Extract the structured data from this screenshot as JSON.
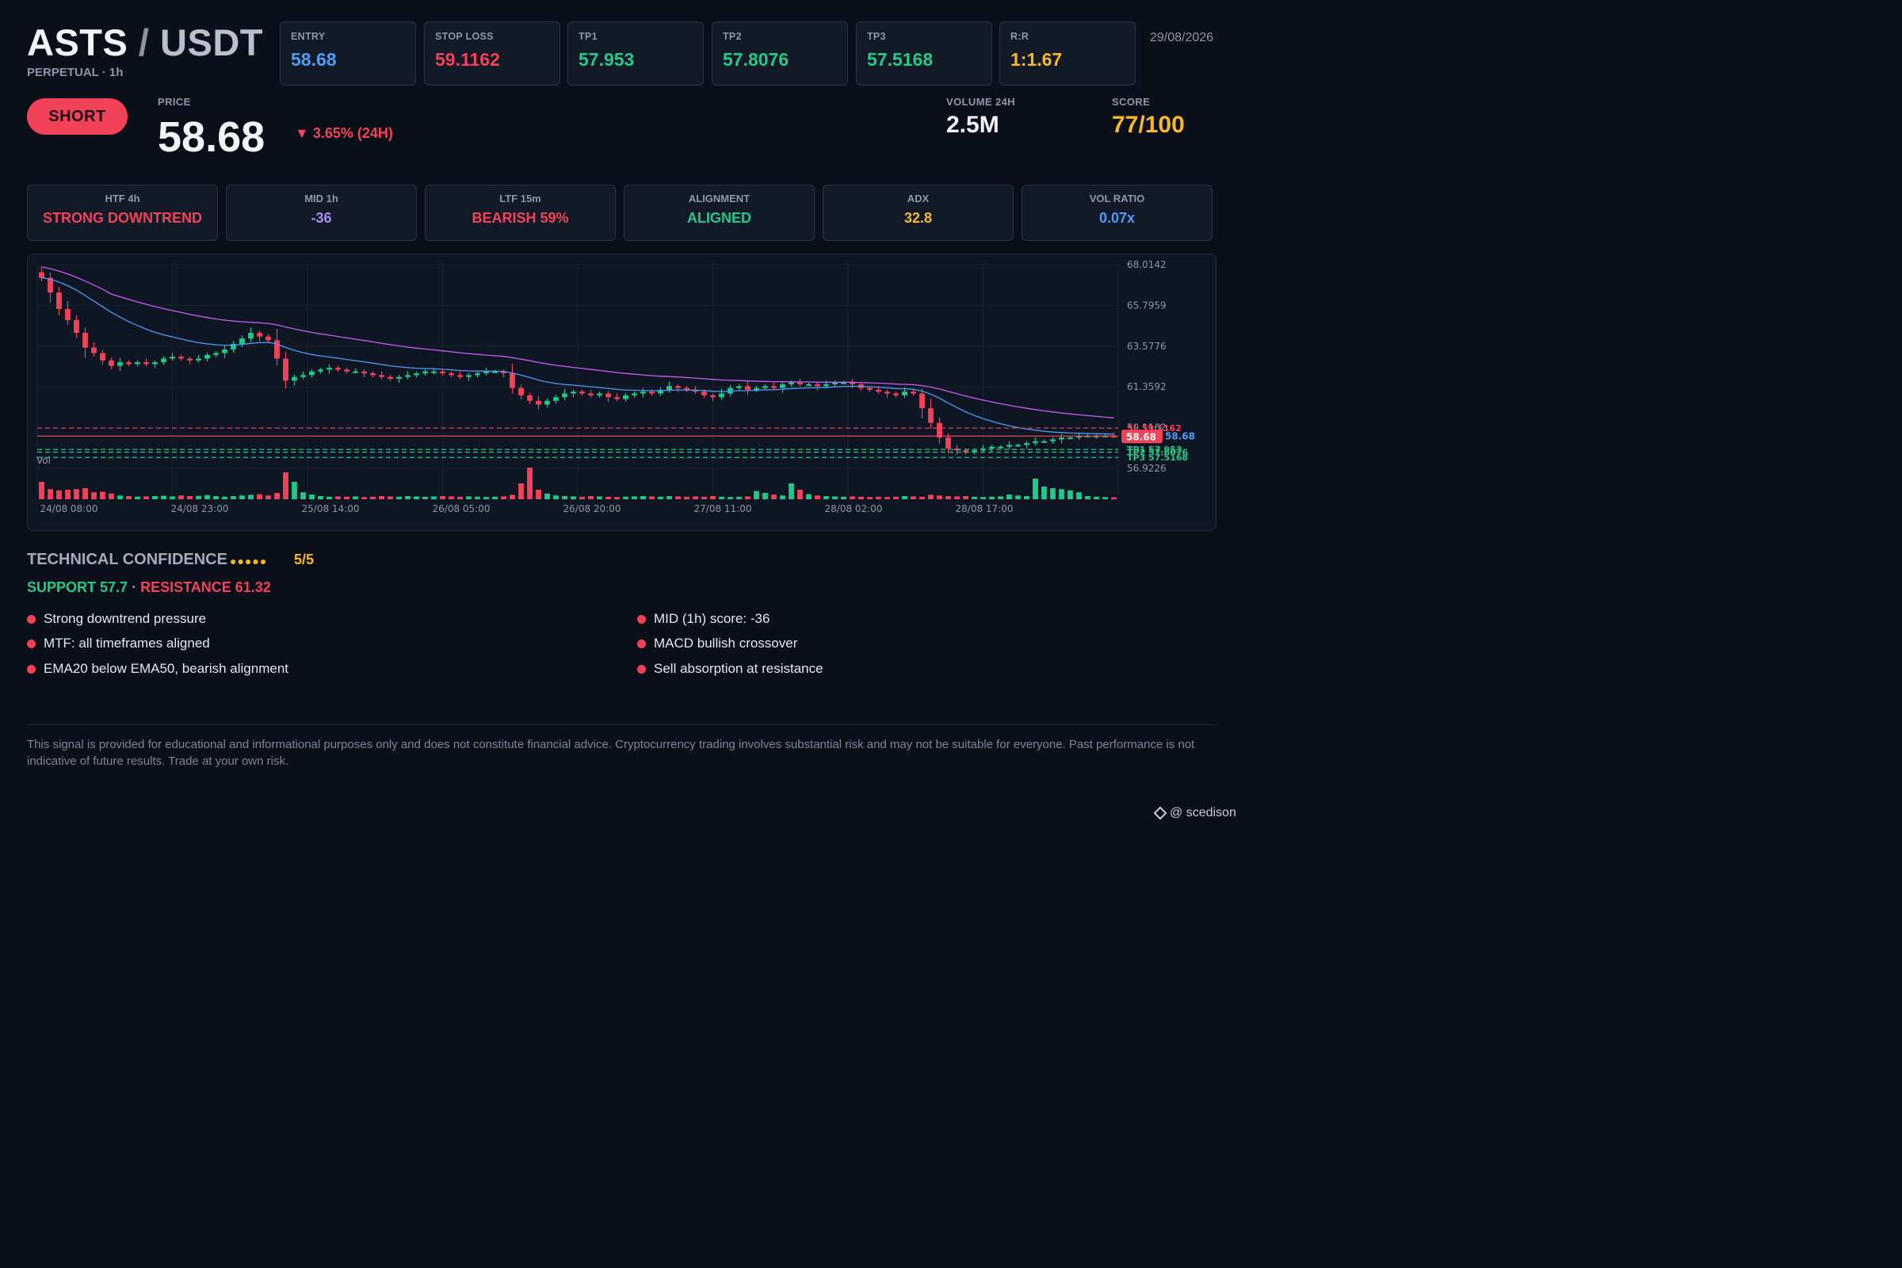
{
  "header": {
    "base": "ASTS",
    "slash": "/",
    "quote": "USDT",
    "subtitle": "PERPETUAL · 1h",
    "date": "29/08/2026"
  },
  "levels": [
    {
      "label": "ENTRY",
      "value": "58.68",
      "color": "#4f9cf7"
    },
    {
      "label": "STOP LOSS",
      "value": "59.1162",
      "color": "#f2425a"
    },
    {
      "label": "TP1",
      "value": "57.953",
      "color": "#27c989"
    },
    {
      "label": "TP2",
      "value": "57.8076",
      "color": "#27c989"
    },
    {
      "label": "TP3",
      "value": "57.5168",
      "color": "#27c989"
    },
    {
      "label": "R:R",
      "value": "1:1.67",
      "color": "#f7b925"
    }
  ],
  "signal": {
    "direction": "SHORT",
    "price_label": "PRICE",
    "price": "58.68",
    "change": "▼ 3.65% (24H)",
    "volume_label": "VOLUME 24H",
    "volume": "2.5M",
    "score_label": "SCORE",
    "score": "77/100"
  },
  "mtf": [
    {
      "label": "HTF 4h",
      "value": "STRONG DOWNTREND",
      "color": "#f2425a"
    },
    {
      "label": "MID 1h",
      "value": "-36",
      "color": "#a98bf2"
    },
    {
      "label": "LTF 15m",
      "value": "BEARISH 59%",
      "color": "#f2425a"
    },
    {
      "label": "ALIGNMENT",
      "value": "ALIGNED",
      "color": "#27c989"
    },
    {
      "label": "ADX",
      "value": "32.8",
      "color": "#f7b925"
    },
    {
      "label": "VOL RATIO",
      "value": "0.07x",
      "color": "#4f9cf7"
    }
  ],
  "chart_data": {
    "type": "candlestick",
    "y_ticks": [
      "68.0142",
      "65.7959",
      "63.5776",
      "61.3592",
      "59.1162",
      "56.9226"
    ],
    "ylim": [
      56.9226,
      68.0142
    ],
    "x_ticks": [
      "24/08 08:00",
      "24/08 23:00",
      "25/08 14:00",
      "26/08 05:00",
      "26/08 20:00",
      "27/08 11:00",
      "28/08 02:00",
      "28/08 17:00"
    ],
    "x_tick_index": [
      0,
      15,
      30,
      45,
      60,
      75,
      90,
      105
    ],
    "volume_label": "Vol",
    "lines": [
      {
        "label": "SL 59.1162",
        "value": 59.1162,
        "color": "#f2425a",
        "dash": true
      },
      {
        "label": "58.68",
        "value": 58.68,
        "color": "#f2425a",
        "dash": false
      },
      {
        "label": "TP1 57.953",
        "value": 57.953,
        "color": "#27c989",
        "dash": true
      },
      {
        "label": "TP2 57.8076",
        "value": 57.8076,
        "color": "#27c989",
        "dash": true
      },
      {
        "label": "TP3 57.5168",
        "value": 57.5168,
        "color": "#27c989",
        "dash": true
      }
    ],
    "last_price": "58.68",
    "ema_value": "58.68",
    "colors": {
      "up": "#1fc98a",
      "down": "#f2425a",
      "ema_fast": "#4f9cf7",
      "ema_slow": "#c85cf2"
    },
    "path": [
      67.6,
      67.3,
      66.5,
      65.6,
      65.0,
      64.3,
      63.5,
      63.2,
      62.8,
      62.5,
      62.7,
      62.6,
      62.7,
      62.6,
      62.7,
      62.9,
      63.0,
      62.9,
      62.8,
      62.9,
      63.1,
      63.2,
      63.4,
      63.7,
      64.0,
      64.3,
      64.1,
      63.9,
      62.9,
      61.7,
      61.9,
      62.0,
      62.2,
      62.3,
      62.4,
      62.3,
      62.2,
      62.2,
      62.1,
      62.0,
      61.9,
      61.8,
      61.9,
      62.0,
      62.1,
      62.2,
      62.2,
      62.1,
      62.0,
      61.9,
      62.0,
      62.1,
      62.2,
      62.2,
      62.1,
      61.3,
      60.9,
      60.6,
      60.4,
      60.6,
      60.8,
      61.0,
      61.1,
      61.0,
      60.9,
      61.0,
      60.8,
      60.7,
      60.9,
      61.0,
      61.1,
      61.0,
      61.2,
      61.4,
      61.3,
      61.2,
      61.1,
      60.9,
      60.8,
      61.0,
      61.3,
      61.4,
      61.2,
      61.3,
      61.4,
      61.3,
      61.5,
      61.6,
      61.5,
      61.5,
      61.4,
      61.5,
      61.6,
      61.6,
      61.5,
      61.3,
      61.2,
      61.1,
      61.0,
      60.9,
      61.1,
      61.0,
      60.2,
      59.4,
      58.6,
      58.0,
      57.9,
      57.8,
      57.9,
      58.0,
      58.1,
      58.1,
      58.2,
      58.2,
      58.3,
      58.4,
      58.4,
      58.5,
      58.6,
      58.6,
      58.7,
      58.7,
      58.7,
      58.7,
      58.68
    ],
    "volume": [
      0.55,
      0.32,
      0.28,
      0.3,
      0.32,
      0.35,
      0.22,
      0.24,
      0.18,
      0.12,
      0.1,
      0.08,
      0.09,
      0.1,
      0.11,
      0.09,
      0.12,
      0.1,
      0.11,
      0.13,
      0.1,
      0.08,
      0.1,
      0.12,
      0.14,
      0.16,
      0.12,
      0.2,
      0.85,
      0.55,
      0.22,
      0.15,
      0.1,
      0.08,
      0.09,
      0.08,
      0.09,
      0.07,
      0.08,
      0.1,
      0.09,
      0.08,
      0.1,
      0.09,
      0.08,
      0.09,
      0.1,
      0.09,
      0.08,
      0.09,
      0.08,
      0.07,
      0.08,
      0.09,
      0.14,
      0.5,
      1.0,
      0.3,
      0.18,
      0.12,
      0.1,
      0.09,
      0.08,
      0.1,
      0.09,
      0.08,
      0.07,
      0.08,
      0.09,
      0.1,
      0.09,
      0.08,
      0.1,
      0.09,
      0.08,
      0.09,
      0.08,
      0.1,
      0.08,
      0.07,
      0.08,
      0.09,
      0.26,
      0.2,
      0.15,
      0.12,
      0.5,
      0.3,
      0.16,
      0.12,
      0.1,
      0.09,
      0.08,
      0.09,
      0.08,
      0.07,
      0.08,
      0.07,
      0.08,
      0.1,
      0.09,
      0.08,
      0.14,
      0.12,
      0.1,
      0.09,
      0.1,
      0.08,
      0.07,
      0.08,
      0.09,
      0.15,
      0.12,
      0.1,
      0.65,
      0.4,
      0.35,
      0.32,
      0.28,
      0.22,
      0.1,
      0.08,
      0.07,
      0.06,
      0.06,
      0.07,
      0.06,
      0.05,
      0.06,
      0.05
    ]
  },
  "technical": {
    "title": "TECHNICAL CONFIDENCE",
    "dots": "●●●●●",
    "score": "5/5",
    "support": "SUPPORT 57.7",
    "separator": "·",
    "resistance": "RESISTANCE 61.32"
  },
  "reasons_left": [
    "Strong downtrend pressure",
    "MTF: all timeframes aligned",
    "EMA20 below EMA50, bearish alignment"
  ],
  "reasons_right": [
    "MID (1h) score: -36",
    "MACD bullish crossover",
    "Sell absorption at resistance"
  ],
  "footer": {
    "disclaimer": "This signal is provided for educational and informational purposes only and does not constitute financial advice. Cryptocurrency trading involves substantial risk and may not be suitable for everyone. Past performance is not indicative of future results. Trade at your own risk.",
    "watermark": "@ scedison"
  }
}
